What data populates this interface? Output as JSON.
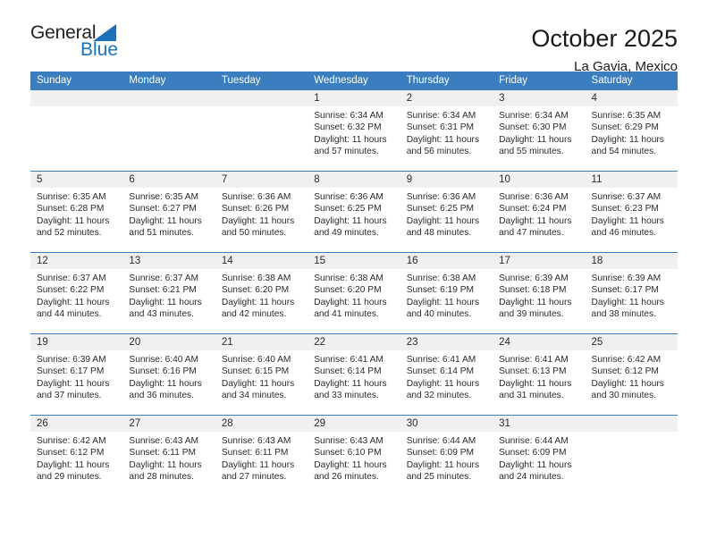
{
  "brand": {
    "name_part1": "General",
    "name_part2": "Blue",
    "triangle_color": "#1d6fb7",
    "blue_color": "#1673c0"
  },
  "header": {
    "title": "October 2025",
    "location": "La Gavia, Mexico"
  },
  "theme": {
    "header_blue": "#3a7ebf",
    "date_strip_gray": "#f0f0f0",
    "cell_white": "#ffffff",
    "text_color": "#2b2b2b"
  },
  "calendar": {
    "weekdays": [
      "Sunday",
      "Monday",
      "Tuesday",
      "Wednesday",
      "Thursday",
      "Friday",
      "Saturday"
    ],
    "weeks": [
      [
        {
          "day": "",
          "lines": []
        },
        {
          "day": "",
          "lines": []
        },
        {
          "day": "",
          "lines": []
        },
        {
          "day": "1",
          "lines": [
            "Sunrise: 6:34 AM",
            "Sunset: 6:32 PM",
            "Daylight: 11 hours",
            "and 57 minutes."
          ]
        },
        {
          "day": "2",
          "lines": [
            "Sunrise: 6:34 AM",
            "Sunset: 6:31 PM",
            "Daylight: 11 hours",
            "and 56 minutes."
          ]
        },
        {
          "day": "3",
          "lines": [
            "Sunrise: 6:34 AM",
            "Sunset: 6:30 PM",
            "Daylight: 11 hours",
            "and 55 minutes."
          ]
        },
        {
          "day": "4",
          "lines": [
            "Sunrise: 6:35 AM",
            "Sunset: 6:29 PM",
            "Daylight: 11 hours",
            "and 54 minutes."
          ]
        }
      ],
      [
        {
          "day": "5",
          "lines": [
            "Sunrise: 6:35 AM",
            "Sunset: 6:28 PM",
            "Daylight: 11 hours",
            "and 52 minutes."
          ]
        },
        {
          "day": "6",
          "lines": [
            "Sunrise: 6:35 AM",
            "Sunset: 6:27 PM",
            "Daylight: 11 hours",
            "and 51 minutes."
          ]
        },
        {
          "day": "7",
          "lines": [
            "Sunrise: 6:36 AM",
            "Sunset: 6:26 PM",
            "Daylight: 11 hours",
            "and 50 minutes."
          ]
        },
        {
          "day": "8",
          "lines": [
            "Sunrise: 6:36 AM",
            "Sunset: 6:25 PM",
            "Daylight: 11 hours",
            "and 49 minutes."
          ]
        },
        {
          "day": "9",
          "lines": [
            "Sunrise: 6:36 AM",
            "Sunset: 6:25 PM",
            "Daylight: 11 hours",
            "and 48 minutes."
          ]
        },
        {
          "day": "10",
          "lines": [
            "Sunrise: 6:36 AM",
            "Sunset: 6:24 PM",
            "Daylight: 11 hours",
            "and 47 minutes."
          ]
        },
        {
          "day": "11",
          "lines": [
            "Sunrise: 6:37 AM",
            "Sunset: 6:23 PM",
            "Daylight: 11 hours",
            "and 46 minutes."
          ]
        }
      ],
      [
        {
          "day": "12",
          "lines": [
            "Sunrise: 6:37 AM",
            "Sunset: 6:22 PM",
            "Daylight: 11 hours",
            "and 44 minutes."
          ]
        },
        {
          "day": "13",
          "lines": [
            "Sunrise: 6:37 AM",
            "Sunset: 6:21 PM",
            "Daylight: 11 hours",
            "and 43 minutes."
          ]
        },
        {
          "day": "14",
          "lines": [
            "Sunrise: 6:38 AM",
            "Sunset: 6:20 PM",
            "Daylight: 11 hours",
            "and 42 minutes."
          ]
        },
        {
          "day": "15",
          "lines": [
            "Sunrise: 6:38 AM",
            "Sunset: 6:20 PM",
            "Daylight: 11 hours",
            "and 41 minutes."
          ]
        },
        {
          "day": "16",
          "lines": [
            "Sunrise: 6:38 AM",
            "Sunset: 6:19 PM",
            "Daylight: 11 hours",
            "and 40 minutes."
          ]
        },
        {
          "day": "17",
          "lines": [
            "Sunrise: 6:39 AM",
            "Sunset: 6:18 PM",
            "Daylight: 11 hours",
            "and 39 minutes."
          ]
        },
        {
          "day": "18",
          "lines": [
            "Sunrise: 6:39 AM",
            "Sunset: 6:17 PM",
            "Daylight: 11 hours",
            "and 38 minutes."
          ]
        }
      ],
      [
        {
          "day": "19",
          "lines": [
            "Sunrise: 6:39 AM",
            "Sunset: 6:17 PM",
            "Daylight: 11 hours",
            "and 37 minutes."
          ]
        },
        {
          "day": "20",
          "lines": [
            "Sunrise: 6:40 AM",
            "Sunset: 6:16 PM",
            "Daylight: 11 hours",
            "and 36 minutes."
          ]
        },
        {
          "day": "21",
          "lines": [
            "Sunrise: 6:40 AM",
            "Sunset: 6:15 PM",
            "Daylight: 11 hours",
            "and 34 minutes."
          ]
        },
        {
          "day": "22",
          "lines": [
            "Sunrise: 6:41 AM",
            "Sunset: 6:14 PM",
            "Daylight: 11 hours",
            "and 33 minutes."
          ]
        },
        {
          "day": "23",
          "lines": [
            "Sunrise: 6:41 AM",
            "Sunset: 6:14 PM",
            "Daylight: 11 hours",
            "and 32 minutes."
          ]
        },
        {
          "day": "24",
          "lines": [
            "Sunrise: 6:41 AM",
            "Sunset: 6:13 PM",
            "Daylight: 11 hours",
            "and 31 minutes."
          ]
        },
        {
          "day": "25",
          "lines": [
            "Sunrise: 6:42 AM",
            "Sunset: 6:12 PM",
            "Daylight: 11 hours",
            "and 30 minutes."
          ]
        }
      ],
      [
        {
          "day": "26",
          "lines": [
            "Sunrise: 6:42 AM",
            "Sunset: 6:12 PM",
            "Daylight: 11 hours",
            "and 29 minutes."
          ]
        },
        {
          "day": "27",
          "lines": [
            "Sunrise: 6:43 AM",
            "Sunset: 6:11 PM",
            "Daylight: 11 hours",
            "and 28 minutes."
          ]
        },
        {
          "day": "28",
          "lines": [
            "Sunrise: 6:43 AM",
            "Sunset: 6:11 PM",
            "Daylight: 11 hours",
            "and 27 minutes."
          ]
        },
        {
          "day": "29",
          "lines": [
            "Sunrise: 6:43 AM",
            "Sunset: 6:10 PM",
            "Daylight: 11 hours",
            "and 26 minutes."
          ]
        },
        {
          "day": "30",
          "lines": [
            "Sunrise: 6:44 AM",
            "Sunset: 6:09 PM",
            "Daylight: 11 hours",
            "and 25 minutes."
          ]
        },
        {
          "day": "31",
          "lines": [
            "Sunrise: 6:44 AM",
            "Sunset: 6:09 PM",
            "Daylight: 11 hours",
            "and 24 minutes."
          ]
        },
        {
          "day": "",
          "lines": []
        }
      ]
    ]
  }
}
